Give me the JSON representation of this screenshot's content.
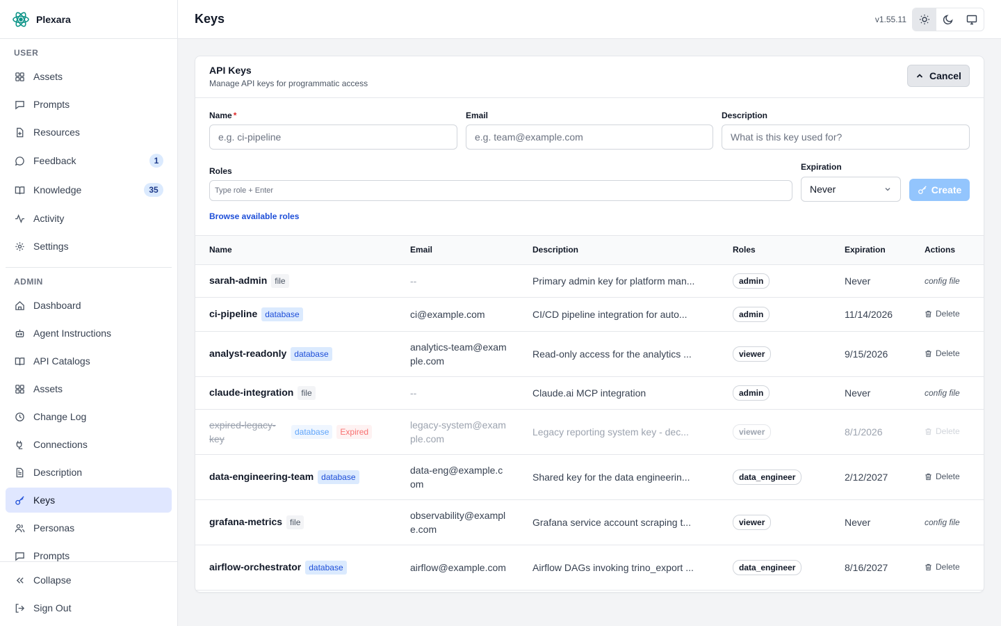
{
  "app": {
    "name": "Plexara"
  },
  "sidebar": {
    "user_section_label": "USER",
    "user_items": [
      {
        "label": "Assets",
        "icon": "grid-icon"
      },
      {
        "label": "Prompts",
        "icon": "message-square-icon"
      },
      {
        "label": "Resources",
        "icon": "file-plus-icon"
      },
      {
        "label": "Feedback",
        "icon": "message-circle-icon",
        "badge": "1"
      },
      {
        "label": "Knowledge",
        "icon": "book-open-icon",
        "badge": "35"
      },
      {
        "label": "Activity",
        "icon": "activity-icon"
      },
      {
        "label": "Settings",
        "icon": "gear-icon"
      }
    ],
    "admin_section_label": "ADMIN",
    "admin_items": [
      {
        "label": "Dashboard",
        "icon": "home-icon"
      },
      {
        "label": "Agent Instructions",
        "icon": "bot-icon"
      },
      {
        "label": "API Catalogs",
        "icon": "book-open-icon"
      },
      {
        "label": "Assets",
        "icon": "grid-icon"
      },
      {
        "label": "Change Log",
        "icon": "clock-icon"
      },
      {
        "label": "Connections",
        "icon": "plug-icon"
      },
      {
        "label": "Description",
        "icon": "file-text-icon"
      },
      {
        "label": "Keys",
        "icon": "key-icon",
        "active": true
      },
      {
        "label": "Personas",
        "icon": "users-icon"
      },
      {
        "label": "Prompts",
        "icon": "message-square-icon"
      }
    ],
    "collapse_label": "Collapse",
    "signout_label": "Sign Out"
  },
  "header": {
    "title": "Keys",
    "version": "v1.55.11",
    "theme_options": [
      "sun-icon",
      "moon-icon",
      "monitor-icon"
    ],
    "active_theme": "sun-icon"
  },
  "card": {
    "title": "API Keys",
    "subtitle": "Manage API keys for programmatic access",
    "cancel_label": "Cancel"
  },
  "form": {
    "name_label": "Name",
    "name_required": "*",
    "name_placeholder": "e.g. ci-pipeline",
    "email_label": "Email",
    "email_placeholder": "e.g. team@example.com",
    "description_label": "Description",
    "description_placeholder": "What is this key used for?",
    "roles_label": "Roles",
    "roles_placeholder": "Type role + Enter",
    "expiration_label": "Expiration",
    "expiration_value": "Never",
    "create_label": "Create",
    "browse_roles_label": "Browse available roles"
  },
  "table": {
    "columns": [
      "Name",
      "Email",
      "Description",
      "Roles",
      "Expiration",
      "Actions"
    ],
    "rows": [
      {
        "name": "sarah-admin",
        "source": "file",
        "email": "--",
        "description": "Primary admin key for platform man...",
        "role": "admin",
        "expiration": "Never",
        "action": "config file"
      },
      {
        "name": "ci-pipeline",
        "source": "database",
        "email": "ci@example.com",
        "description": "CI/CD pipeline integration for auto...",
        "role": "admin",
        "expiration": "11/14/2026",
        "action": "Delete"
      },
      {
        "name": "analyst-readonly",
        "source": "database",
        "email": "analytics-team@example.com",
        "description": "Read-only access for the analytics ...",
        "role": "viewer",
        "expiration": "9/15/2026",
        "action": "Delete"
      },
      {
        "name": "claude-integration",
        "source": "file",
        "email": "--",
        "description": "Claude.ai MCP integration",
        "role": "admin",
        "expiration": "Never",
        "action": "config file"
      },
      {
        "name": "expired-legacy-key",
        "source": "database",
        "status": "Expired",
        "email": "legacy-system@example.com",
        "description": "Legacy reporting system key - dec...",
        "role": "viewer",
        "expiration": "8/1/2026",
        "action": "Delete"
      },
      {
        "name": "data-engineering-team",
        "source": "database",
        "email": "data-eng@example.com",
        "description": "Shared key for the data engineerin...",
        "role": "data_engineer",
        "expiration": "2/12/2027",
        "action": "Delete"
      },
      {
        "name": "grafana-metrics",
        "source": "file",
        "email": "observability@example.com",
        "description": "Grafana service account scraping t...",
        "role": "viewer",
        "expiration": "Never",
        "action": "config file"
      },
      {
        "name": "airflow-orchestrator",
        "source": "database",
        "email": "airflow@example.com",
        "description": "Airflow DAGs invoking trino_export ...",
        "role": "data_engineer",
        "expiration": "8/16/2027",
        "action": "Delete"
      }
    ]
  },
  "colors": {
    "accent": "#1d4ed8",
    "active_nav_bg": "#e0e7ff",
    "create_button": "#93c5fd",
    "expired": "#dc2626"
  }
}
